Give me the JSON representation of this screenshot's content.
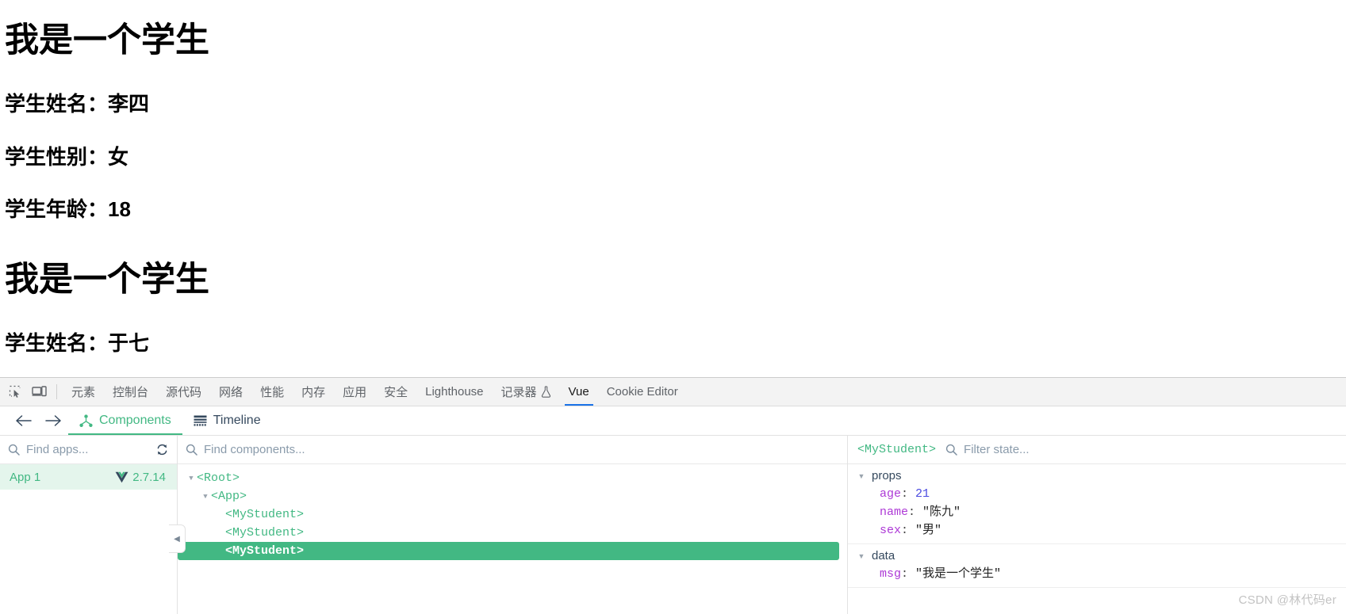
{
  "page": {
    "blocks": [
      {
        "heading": "我是一个学生",
        "lines": [
          "学生姓名：李四",
          "学生性别：女",
          "学生年龄：18"
        ]
      },
      {
        "heading": "我是一个学生",
        "lines": [
          "学生姓名：于七"
        ]
      }
    ],
    "h1_a": "我是一个学生",
    "p1": "学生姓名：李四",
    "p2": "学生性别：女",
    "p3": "学生年龄：18",
    "h1_b": "我是一个学生",
    "p4": "学生姓名：于七"
  },
  "devtools": {
    "icons": {
      "inspect": "inspect-element-icon",
      "device": "device-toolbar-icon"
    },
    "tabs": [
      {
        "label": "元素",
        "active": false
      },
      {
        "label": "控制台",
        "active": false
      },
      {
        "label": "源代码",
        "active": false
      },
      {
        "label": "网络",
        "active": false
      },
      {
        "label": "性能",
        "active": false
      },
      {
        "label": "内存",
        "active": false
      },
      {
        "label": "应用",
        "active": false
      },
      {
        "label": "安全",
        "active": false
      },
      {
        "label": "Lighthouse",
        "active": false
      },
      {
        "label": "记录器",
        "active": false,
        "icon": "flask-icon"
      },
      {
        "label": "Vue",
        "active": true
      },
      {
        "label": "Cookie Editor",
        "active": false
      }
    ],
    "tab_labels": {
      "elements": "元素",
      "console": "控制台",
      "sources": "源代码",
      "network": "网络",
      "performance": "性能",
      "memory": "内存",
      "application": "应用",
      "security": "安全",
      "lighthouse": "Lighthouse",
      "recorder": "记录器",
      "vue": "Vue",
      "cookie_editor": "Cookie Editor"
    },
    "accent_active_tab": "#1a73e8"
  },
  "vue_panel": {
    "nav": {
      "back": "←",
      "forward": "→"
    },
    "tabs": {
      "components": "Components",
      "timeline": "Timeline"
    },
    "accent": "#42b883",
    "apps": {
      "search_placeholder": "Find apps...",
      "refresh_icon": "refresh-icon",
      "items": [
        {
          "name": "App 1",
          "version": "2.7.14",
          "selected": true
        }
      ]
    },
    "tree": {
      "search_placeholder": "Find components...",
      "nodes": [
        {
          "label": "<Root>",
          "depth": 0,
          "expanded": true,
          "selected": false
        },
        {
          "label": "<App>",
          "depth": 1,
          "expanded": true,
          "selected": false
        },
        {
          "label": "<MyStudent>",
          "depth": 2,
          "expanded": false,
          "selected": false
        },
        {
          "label": "<MyStudent>",
          "depth": 2,
          "expanded": false,
          "selected": false
        },
        {
          "label": "<MyStudent>",
          "depth": 2,
          "expanded": false,
          "selected": true
        }
      ]
    },
    "state": {
      "component": "<MyStudent>",
      "filter_placeholder": "Filter state...",
      "groups": [
        {
          "title": "props",
          "expanded": true,
          "entries": [
            {
              "key": "age",
              "value": "21",
              "kind": "number"
            },
            {
              "key": "name",
              "value": "\"陈九\"",
              "kind": "string"
            },
            {
              "key": "sex",
              "value": "\"男\"",
              "kind": "string"
            }
          ]
        },
        {
          "title": "data",
          "expanded": true,
          "entries": [
            {
              "key": "msg",
              "value": "\"我是一个学生\"",
              "kind": "string"
            }
          ]
        }
      ]
    }
  },
  "watermark": "CSDN @林代码er"
}
